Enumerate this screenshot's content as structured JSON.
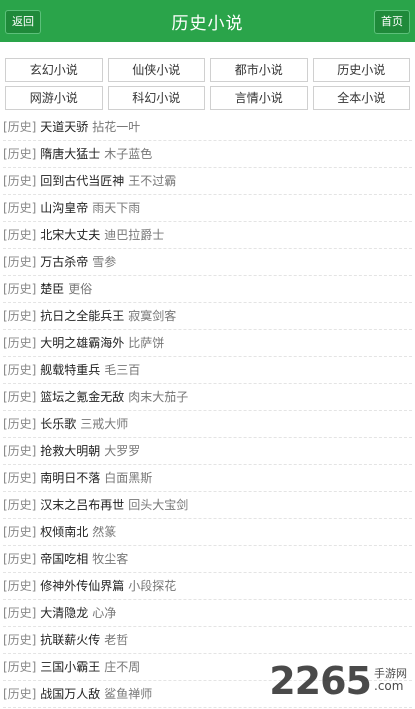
{
  "header": {
    "back_label": "返回",
    "title": "历史小说",
    "home_label": "首页"
  },
  "categories": [
    "玄幻小说",
    "仙侠小说",
    "都市小说",
    "历史小说",
    "网游小说",
    "科幻小说",
    "言情小说",
    "全本小说"
  ],
  "books": [
    {
      "tag": "[历史]",
      "title": "天道天骄",
      "author": "拈花一叶"
    },
    {
      "tag": "[历史]",
      "title": "隋唐大猛士",
      "author": "木子蓝色"
    },
    {
      "tag": "[历史]",
      "title": "回到古代当匠神",
      "author": "王不过霸"
    },
    {
      "tag": "[历史]",
      "title": "山沟皇帝",
      "author": "雨天下雨"
    },
    {
      "tag": "[历史]",
      "title": "北宋大丈夫",
      "author": "迪巴拉爵士"
    },
    {
      "tag": "[历史]",
      "title": "万古杀帝",
      "author": "雪参"
    },
    {
      "tag": "[历史]",
      "title": "楚臣",
      "author": "更俗"
    },
    {
      "tag": "[历史]",
      "title": "抗日之全能兵王",
      "author": "寂寞剑客"
    },
    {
      "tag": "[历史]",
      "title": "大明之雄霸海外",
      "author": "比萨饼"
    },
    {
      "tag": "[历史]",
      "title": "舰载特重兵",
      "author": "毛三百"
    },
    {
      "tag": "[历史]",
      "title": "篮坛之氪金无敌",
      "author": "肉末大茄子"
    },
    {
      "tag": "[历史]",
      "title": "长乐歌",
      "author": "三戒大师"
    },
    {
      "tag": "[历史]",
      "title": "抢救大明朝",
      "author": "大罗罗"
    },
    {
      "tag": "[历史]",
      "title": "南明日不落",
      "author": "白面黑斯"
    },
    {
      "tag": "[历史]",
      "title": "汉末之吕布再世",
      "author": "回头大宝剑"
    },
    {
      "tag": "[历史]",
      "title": "权倾南北",
      "author": "然篆"
    },
    {
      "tag": "[历史]",
      "title": "帝国吃相",
      "author": "牧尘客"
    },
    {
      "tag": "[历史]",
      "title": "修神外传仙界篇",
      "author": "小段探花"
    },
    {
      "tag": "[历史]",
      "title": "大清隐龙",
      "author": "心净"
    },
    {
      "tag": "[历史]",
      "title": "抗联薪火传",
      "author": "老哲"
    },
    {
      "tag": "[历史]",
      "title": "三国小霸王",
      "author": "庄不周"
    },
    {
      "tag": "[历史]",
      "title": "战国万人敌",
      "author": "鲨鱼禅师"
    }
  ],
  "watermark": {
    "number": "2265",
    "cn": "手游网",
    "domain": ".com"
  },
  "colors": {
    "header_bg": "#2aa44a",
    "button_bg": "#1f8a3a"
  }
}
